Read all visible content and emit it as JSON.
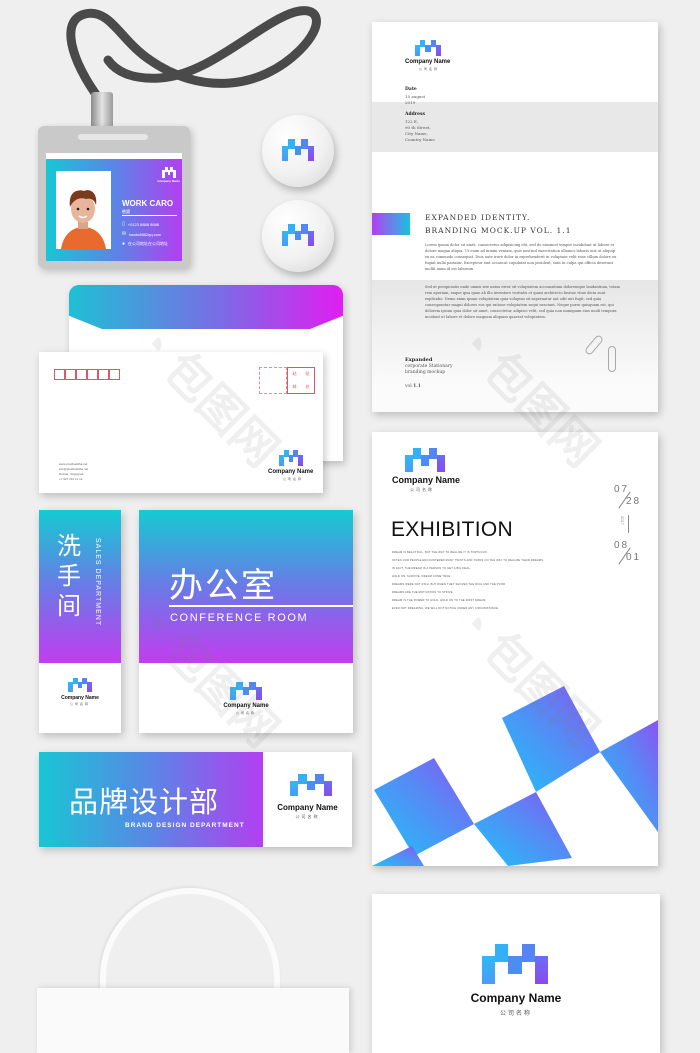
{
  "brand": {
    "company_name": "Company Name",
    "company_name_zh": "公司名称",
    "colors": {
      "cyan": "#18c6d4",
      "blue": "#4a8ef4",
      "purple": "#b23ff0",
      "magenta": "#e01ef0",
      "stamp_red": "#e0556a"
    },
    "logo_icon": "pixel-m-logo-icon"
  },
  "id_card": {
    "title": "WORK CARO",
    "name": "慈盟",
    "phone": "+0123 8888 8888",
    "email": "baotu8882qq.com",
    "address": "在公司地址在公司地址",
    "phone_icon": "phone-icon",
    "email_icon": "mail-icon",
    "address_icon": "location-pin-icon",
    "photo": "avatar-illustration"
  },
  "letterhead": {
    "date_label": "Date",
    "date_lines": [
      "15 august",
      "2019"
    ],
    "address_label": "Address",
    "address_lines": [
      "122 E,",
      "90 th Street,",
      "City Name,",
      "Country Name"
    ],
    "heading_lines": [
      "EXPANDED IDENTITY.",
      "BRANDING MOCK.UP VOL. 1.1"
    ],
    "paragraph_1": "Lorem ipsum dolor sit amet, consectetur adipisicing elit, sed do eiusmod tempor incididunt ut labore et dolore magna aliqua. Ut enim ad minim veniam, quis nostrud exercitation ullamco laboris nisi ut aliquip ex ea commodo consequat. Duis aute irure dolor in reprehenderit in voluptate velit esse cillum dolore eu fugiat nulla pariatur. Excepteur sint occaecat cupidatat non proident, sunt in culpa qui officia deserunt mollit anim id est laborum.",
    "paragraph_2": "Sed ut perspiciatis unde omnis iste natus error sit voluptatem accusantium doloremque laudantium, totam rem aperiam, eaque ipsa quae ab illo inventore veritatis et quasi architecto beatae vitae dicta sunt explicabo. Nemo enim ipsam voluptatem quia voluptas sit aspernatur aut odit aut fugit, sed quia consequuntur magni dolores eos qui ratione voluptatem sequi nesciunt. Neque porro quisquam est, qui dolorem ipsum quia dolor sit amet, consectetur, adipisci velit, sed quia non numquam eius modi tempora incidunt ut labore et dolore magnam aliquam quaerat voluptatem.",
    "footer_bold": "Expanded",
    "footer_lines": [
      "corporate Stationary",
      "branding mockup"
    ],
    "vol_prefix": "vol.",
    "vol_number": "1.1"
  },
  "envelope": {
    "stamp_chars": [
      "粘",
      "贴",
      "邮",
      "处"
    ],
    "info_lines": [
      "www.pixelbuddha.net",
      "info@pixelbuddha.net",
      "Russia, Volgograd",
      "+7 927 231 12 12"
    ]
  },
  "signs": {
    "restroom": {
      "zh": "洗手间",
      "en": "SALES DEPARTMENT"
    },
    "office": {
      "zh": "办公室",
      "en": "CONFERENCE ROOM"
    },
    "brand_dept": {
      "zh": "品牌设计部",
      "en": "BRAND DESIGN DEPARTMENT"
    }
  },
  "poster": {
    "title": "EXHIBITION",
    "lines": [
      "DREAM IS BEAUTIFUL, BUT THE WAY TO REALIZE IT IS TORTUOUS.",
      "OFTEN OUR PEOPLE ENCOUNTERED MANY TWISTS AND TURNS ON THE WAY TO REALIZE THEIR DREAMS.",
      "IN FACT, THE DREAM IS A PERSON TO GET A BIG DEAL.",
      "HOLD ON, SURVIVE, DREAM COME TRUE.",
      "DREAMS WERE NOT RICH, BUT WHEN THEY SHOVED THE RICH AND THE POOR.",
      "DREAMS ARE THE MOTIVATION TO STRIVE.",
      "DREAM IS THE POWER TO HOLD, HOLD ON TO THE FIRST DREAM.",
      "EVEN NOT DREAMING, WE WILL NOT NOTICE UNDER ANY CIRCUMSTANCE."
    ],
    "date_start": [
      "07",
      "28"
    ],
    "year": "2017",
    "date_end": [
      "08",
      "01"
    ]
  }
}
